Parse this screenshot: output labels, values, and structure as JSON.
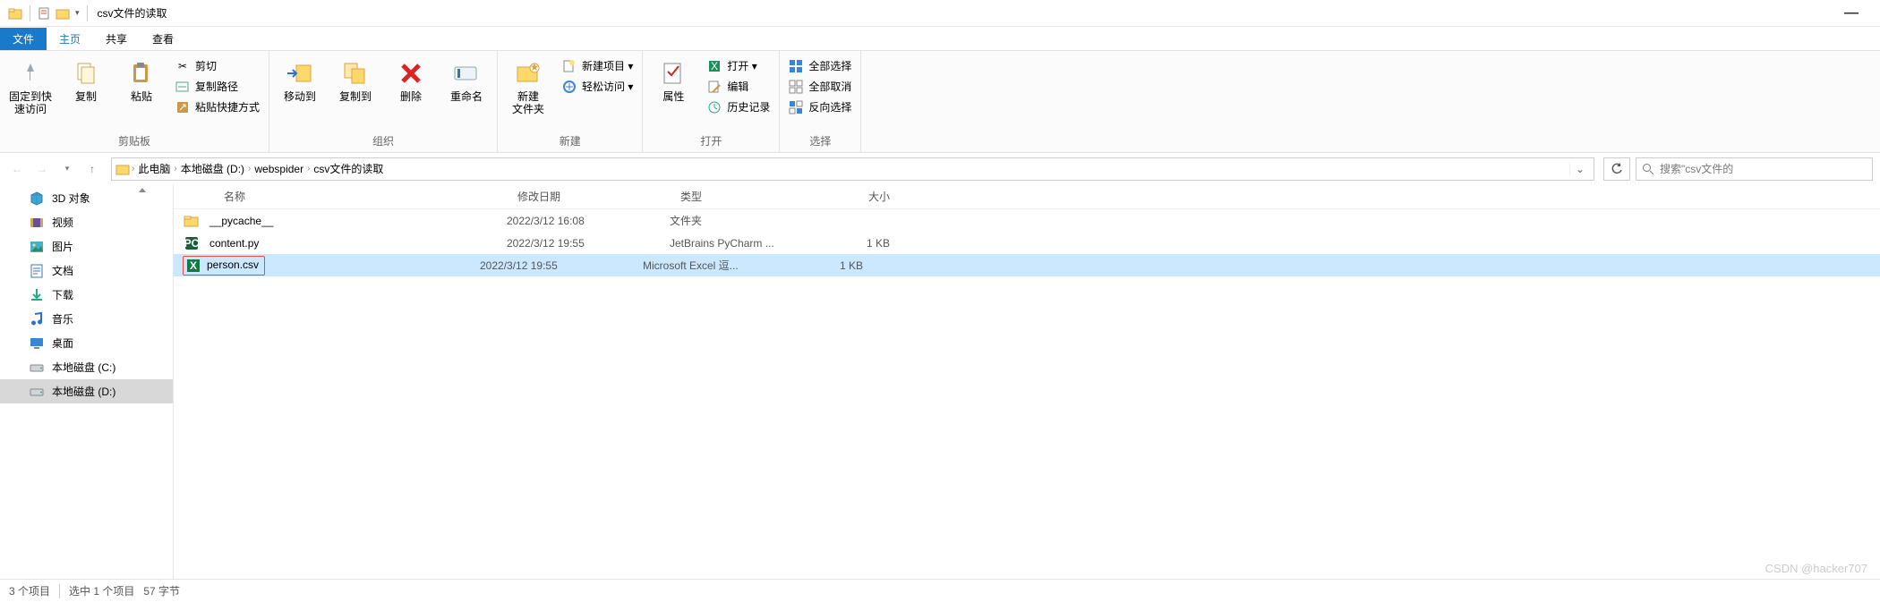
{
  "window": {
    "title": "csv文件的读取"
  },
  "tabs": {
    "file": "文件",
    "home": "主页",
    "share": "共享",
    "view": "查看"
  },
  "ribbon": {
    "clipboard": {
      "pin": "固定到快\n速访问",
      "copy": "复制",
      "paste": "粘贴",
      "cut": "剪切",
      "copypath": "复制路径",
      "pasteshortcut": "粘贴快捷方式",
      "label": "剪贴板"
    },
    "organize": {
      "moveto": "移动到",
      "copyto": "复制到",
      "delete": "删除",
      "rename": "重命名",
      "label": "组织"
    },
    "new": {
      "newfolder": "新建\n文件夹",
      "newitem": "新建项目 ▾",
      "easyaccess": "轻松访问 ▾",
      "label": "新建"
    },
    "open": {
      "properties": "属性",
      "open": "打开 ▾",
      "edit": "编辑",
      "history": "历史记录",
      "label": "打开"
    },
    "select": {
      "all": "全部选择",
      "none": "全部取消",
      "invert": "反向选择",
      "label": "选择"
    }
  },
  "breadcrumbs": [
    "此电脑",
    "本地磁盘 (D:)",
    "webspider",
    "csv文件的读取"
  ],
  "search_placeholder": "搜索\"csv文件的",
  "sidebar": [
    {
      "label": "3D 对象",
      "icon": "cube"
    },
    {
      "label": "视频",
      "icon": "video"
    },
    {
      "label": "图片",
      "icon": "image"
    },
    {
      "label": "文档",
      "icon": "doc"
    },
    {
      "label": "下载",
      "icon": "download"
    },
    {
      "label": "音乐",
      "icon": "music"
    },
    {
      "label": "桌面",
      "icon": "desktop"
    },
    {
      "label": "本地磁盘 (C:)",
      "icon": "drive"
    },
    {
      "label": "本地磁盘 (D:)",
      "icon": "drive",
      "selected": true
    }
  ],
  "columns": {
    "name": "名称",
    "date": "修改日期",
    "type": "类型",
    "size": "大小"
  },
  "files": [
    {
      "name": "__pycache__",
      "date": "2022/3/12 16:08",
      "type": "文件夹",
      "size": "",
      "icon": "folder"
    },
    {
      "name": "content.py",
      "date": "2022/3/12 19:55",
      "type": "JetBrains PyCharm ...",
      "size": "1 KB",
      "icon": "py"
    },
    {
      "name": "person.csv",
      "date": "2022/3/12 19:55",
      "type": "Microsoft Excel 逗...",
      "size": "1 KB",
      "icon": "xl",
      "selected": true,
      "highlight": true
    }
  ],
  "status": {
    "count": "3 个项目",
    "selected": "选中 1 个项目",
    "bytes": "57 字节"
  },
  "watermark": "CSDN @hacker707"
}
